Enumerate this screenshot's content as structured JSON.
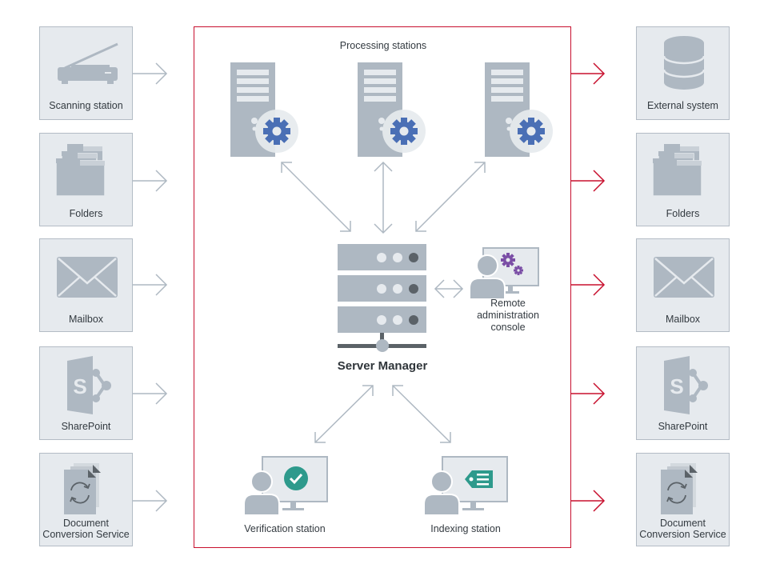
{
  "diagram": {
    "title": "Server Manager",
    "processing_label": "Processing stations",
    "colors": {
      "frame_red": "#c8102e",
      "tile_bg": "#e6eaee",
      "tile_border": "#b3bcc5",
      "icon_gray": "#aeb8c2",
      "gear_blue": "#4a6fb5",
      "gear_purple": "#7b4fa6",
      "teal": "#2e9a8c",
      "dark_gray": "#5b6268"
    },
    "inputs": [
      {
        "label": "Scanning station",
        "icon": "scanner-icon"
      },
      {
        "label": "Folders",
        "icon": "folders-icon"
      },
      {
        "label": "Mailbox",
        "icon": "envelope-icon"
      },
      {
        "label": "SharePoint",
        "icon": "sharepoint-icon"
      },
      {
        "label_line1": "Document",
        "label_line2": "Conversion Service",
        "icon": "document-conversion-icon"
      }
    ],
    "outputs": [
      {
        "label": "External system",
        "icon": "database-icon"
      },
      {
        "label": "Folders",
        "icon": "folders-icon"
      },
      {
        "label": "Mailbox",
        "icon": "envelope-icon"
      },
      {
        "label": "SharePoint",
        "icon": "sharepoint-icon"
      },
      {
        "label_line1": "Document",
        "label_line2": "Conversion Service",
        "icon": "document-conversion-icon"
      }
    ],
    "processing_stations": [
      {
        "icon": "server-gear-icon"
      },
      {
        "icon": "server-gear-icon"
      },
      {
        "icon": "server-gear-icon"
      }
    ],
    "remote_console": {
      "line1": "Remote",
      "line2": "administration",
      "line3": "console"
    },
    "verification": {
      "label": "Verification station"
    },
    "indexing": {
      "label": "Indexing station"
    }
  }
}
